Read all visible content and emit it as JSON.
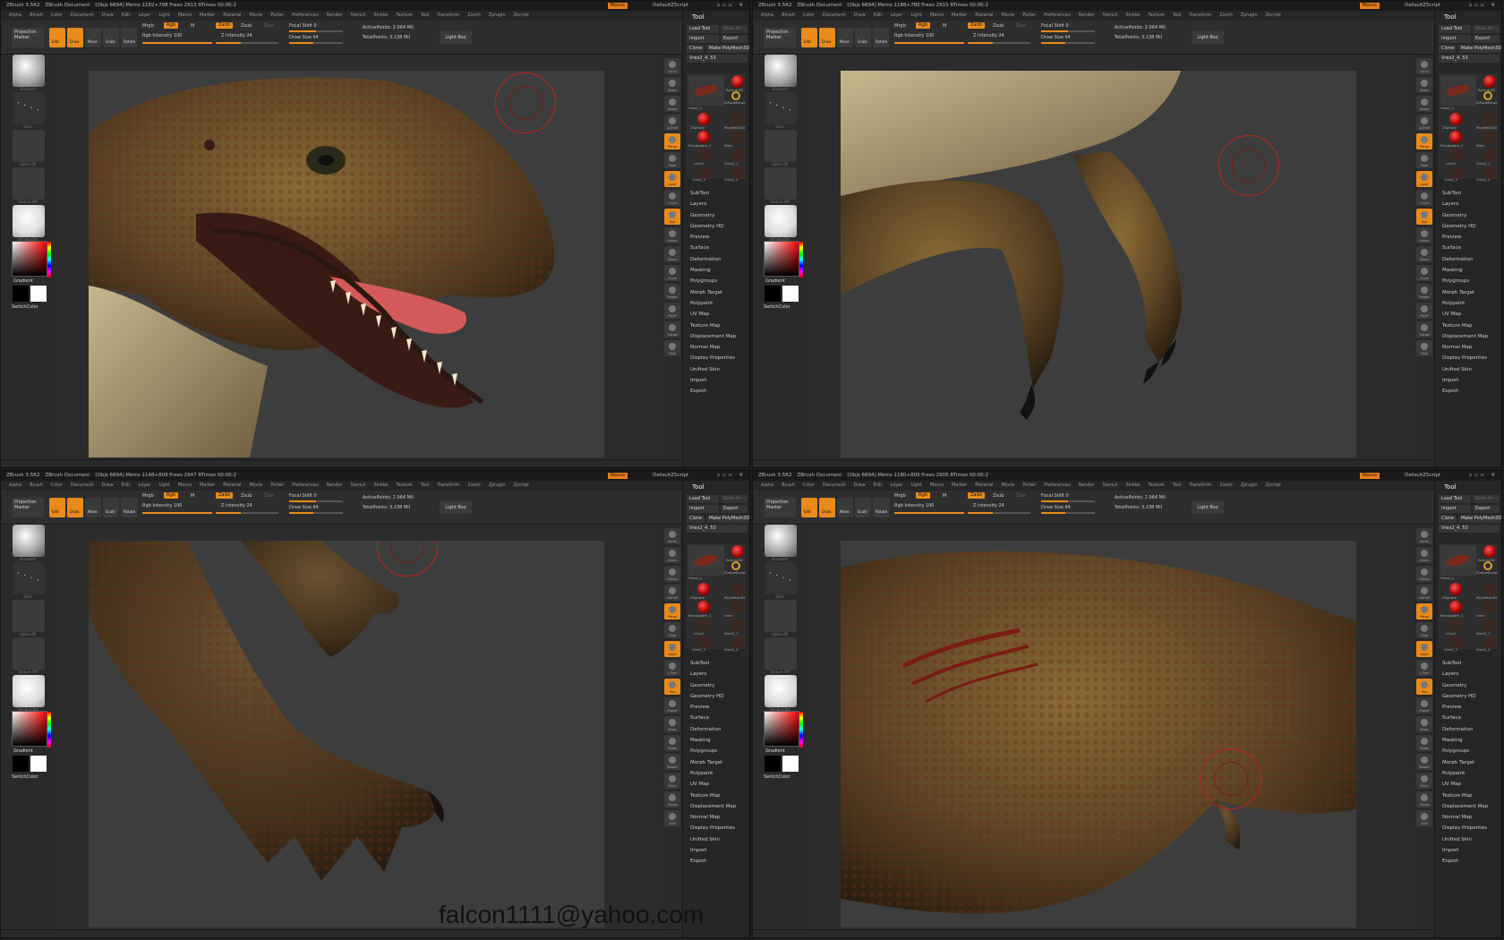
{
  "title_bar": {
    "app": "ZBrush 3.5R2",
    "document": "ZBrush Document",
    "stats": [
      "[Objs 6894] Mems 1182+798 Frees 2913 RTimes 00:00:2",
      "[Objs 6894] Mems 1188+780 Frees 2915 RTimes 00:00:2",
      "[Objs 6894] Mems 1148+809 Frees 2947 RTimes 00:00:2",
      "[Objs 6894] Mems 1180+800 Frees 2905 RTimes 00:00:2"
    ],
    "menus_button": "Menus",
    "script": "DefaultZScript"
  },
  "menu_bar": [
    "Alpha",
    "Brush",
    "Color",
    "Document",
    "Draw",
    "Edit",
    "Layer",
    "Light",
    "Macro",
    "Marker",
    "Material",
    "Movie",
    "Picker",
    "Preferences",
    "Render",
    "Stencil",
    "Stroke",
    "Texture",
    "Tool",
    "Transform",
    "Zoom",
    "Zplugin",
    "Zscript"
  ],
  "shelf": {
    "projection_master": "Projection Master",
    "edit": "Edit",
    "draw": "Draw",
    "move": "Move",
    "scale": "Scale",
    "rotate": "Rotate",
    "mrgb": "Mrgb",
    "rgb": "Rgb",
    "m": "M",
    "rgb_intensity": "Rgb Intensity 100",
    "zadd": "Zadd",
    "zsub": "Zsub",
    "zcut": "Zcut",
    "z_intensity": "Z Intensity 24",
    "focal_shift": "Focal Shift 0",
    "draw_size": "Draw Size 64",
    "active_points": "ActivePoints: 2.964 Mil",
    "total_points": "TotalPoints: 3.138 Mil",
    "light_box": "Light Box"
  },
  "left_shelf": {
    "standard": "Standard",
    "dots": "Dots",
    "alpha_off": "Alpha Off",
    "texture_off": "Texture Off",
    "material": "SkinShade4",
    "gradient": "Gradient",
    "switch_color": "SwitchColor"
  },
  "right_shelf": [
    "Scroll",
    "Zoom",
    "Actual",
    "AAHalf",
    "Persp",
    "Floor",
    "Local",
    "L.Sym",
    "Xyz",
    "Frame",
    "Move",
    "Scale",
    "Rotate",
    "PolyF",
    "Transp",
    "Solo"
  ],
  "tool_panel": {
    "title": "Tool",
    "load_tool": "Load Tool",
    "save_as": "Save As",
    "import": "Import",
    "export": "Export",
    "clone": "Clone",
    "make_polymesh": "Make PolyMesh3D",
    "current": "Vrex2_4. 53",
    "thumbs": [
      "Vrex2_4",
      "Sphere3D",
      "SimpleBrush",
      "ZSphere",
      "PolyMesh3D",
      "PolySphere_1",
      "Vrex",
      "Vrex2",
      "Vrex2_1",
      "Vrex2_3",
      "Vrex2_4"
    ],
    "items": [
      "SubTool",
      "Layers",
      "Geometry",
      "Geometry HD",
      "Preview",
      "Surface",
      "Deformation",
      "Masking",
      "Polygroups",
      "Morph Target",
      "Polypaint",
      "UV Map",
      "Texture Map",
      "Displacement Map",
      "Normal Map",
      "Display Properties",
      "Unified Skin",
      "Import",
      "Export"
    ]
  },
  "watermark": "falcon1111@yahoo.com",
  "colors": {
    "accent": "#e88a1c",
    "brush_circle": "#c0221c",
    "background": "#3d3d3d"
  }
}
